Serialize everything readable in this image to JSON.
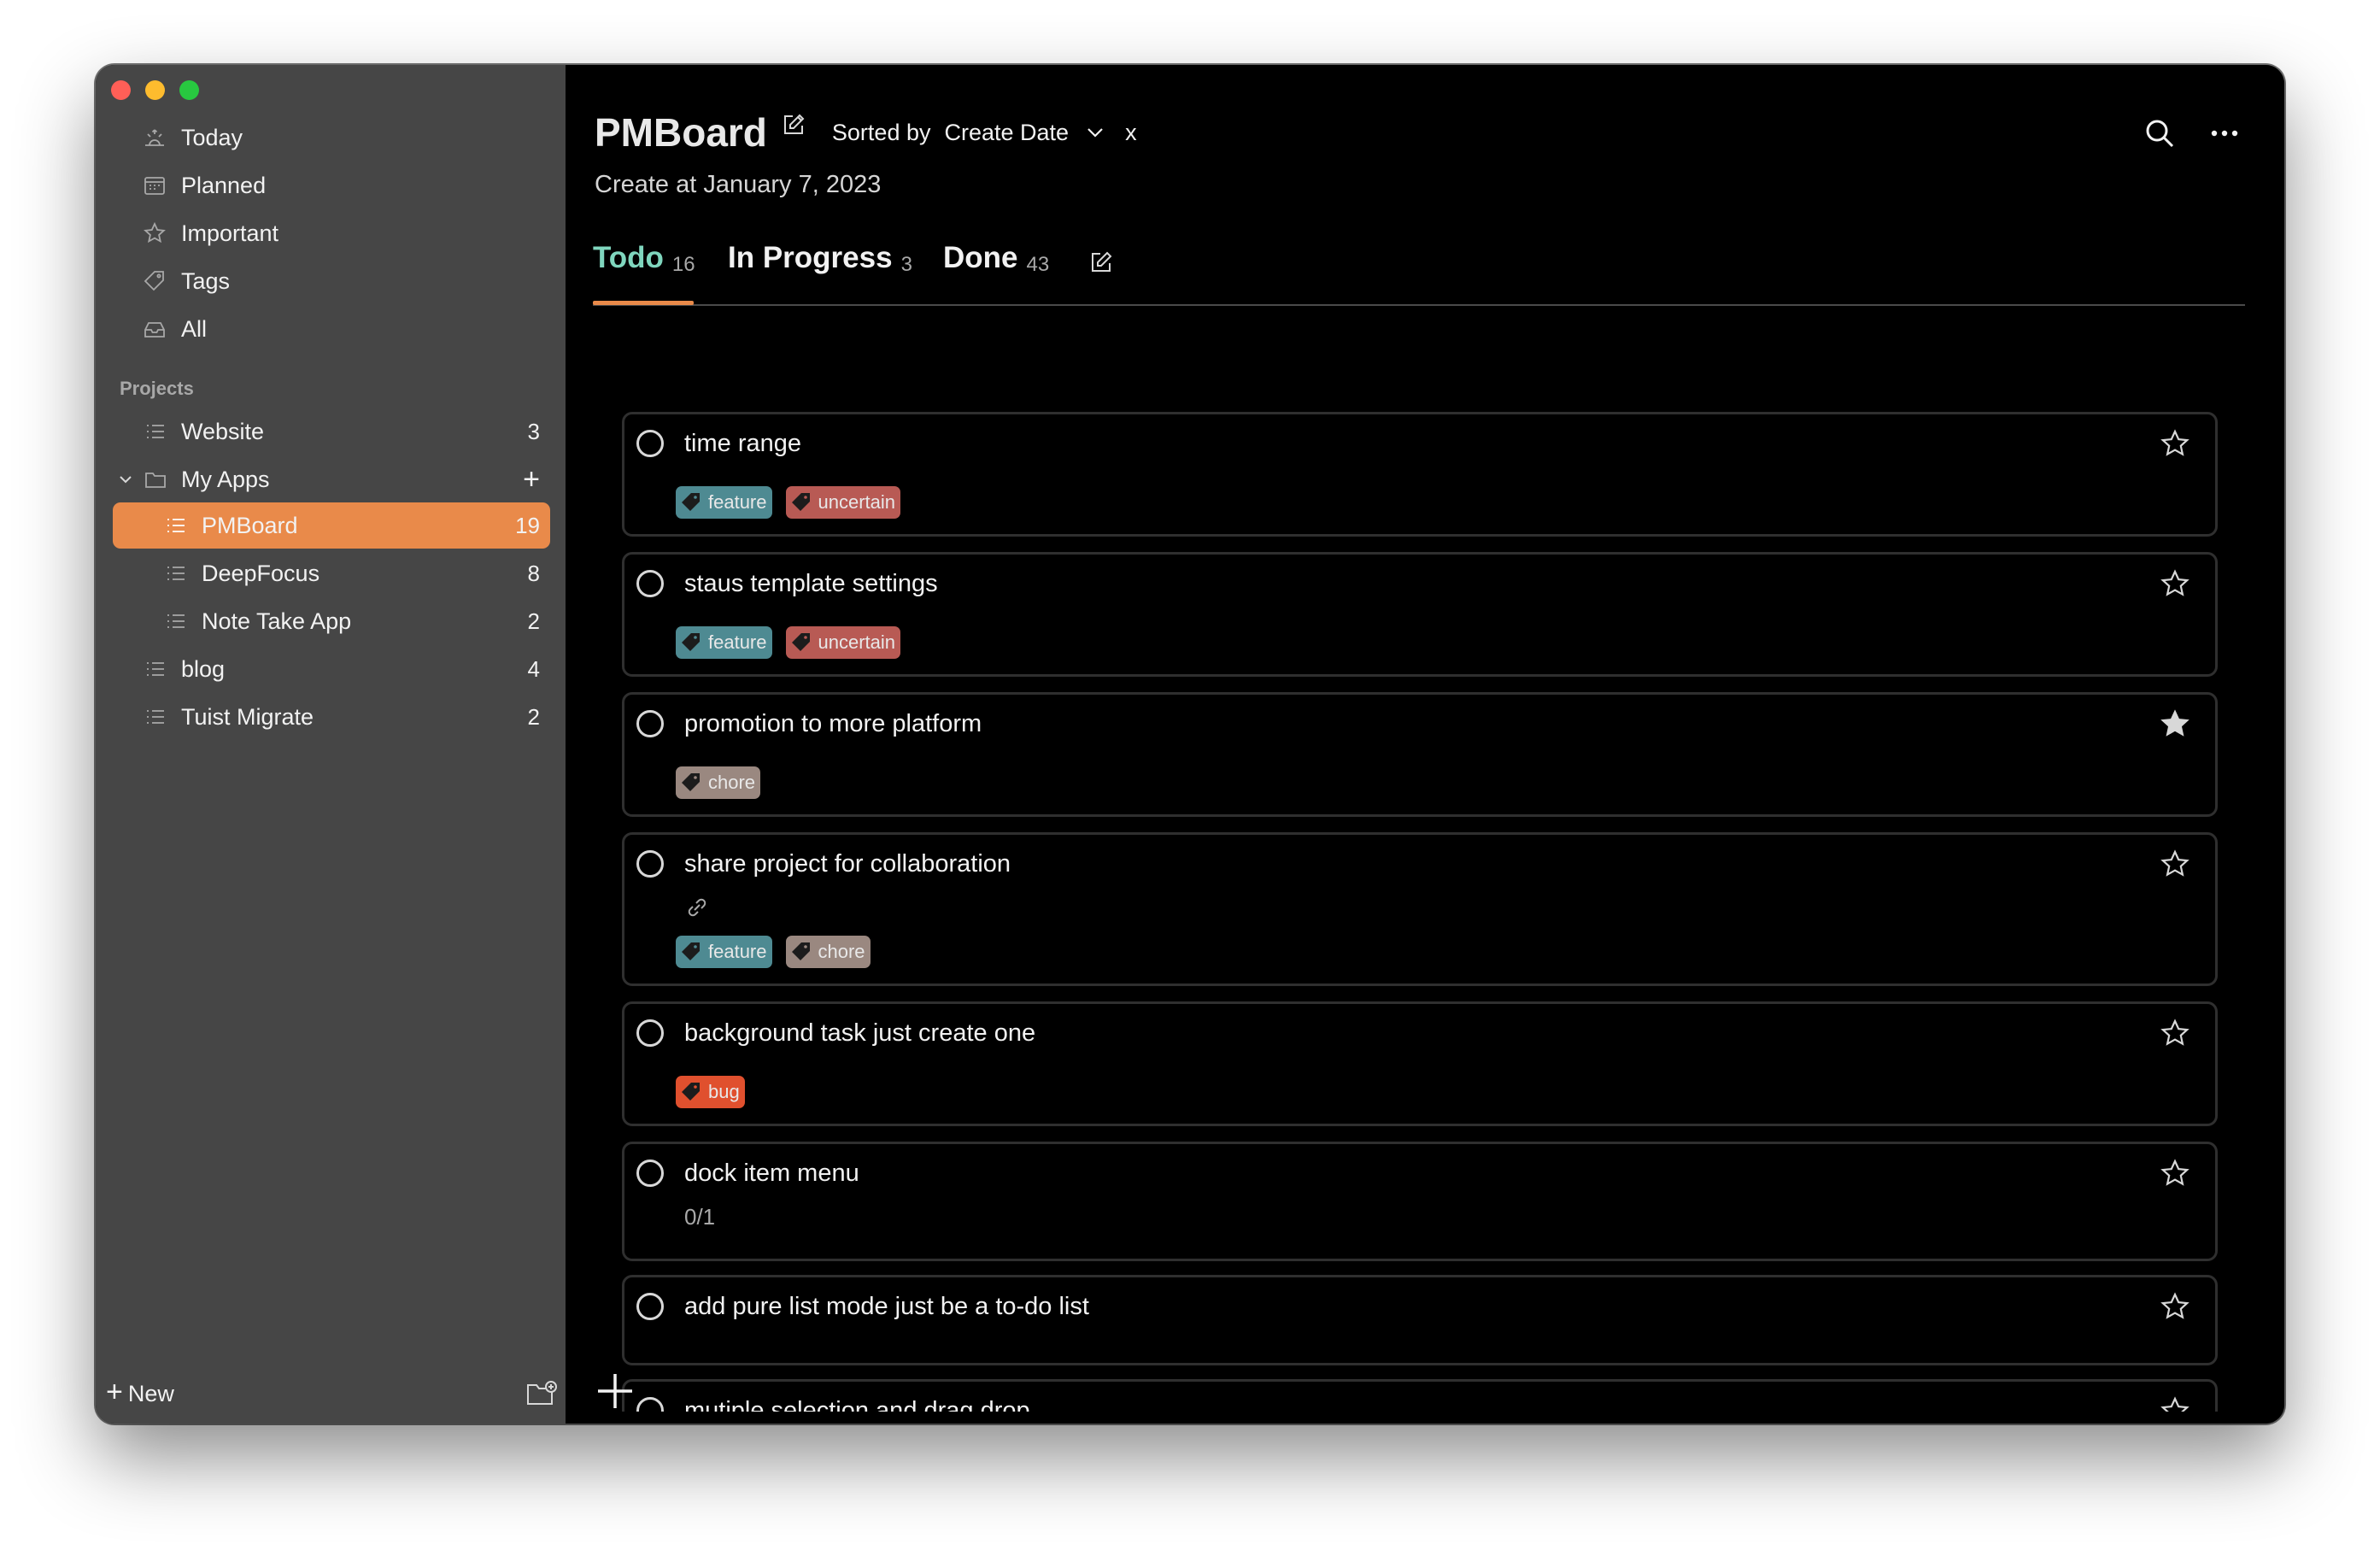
{
  "sidebar": {
    "nav": [
      {
        "label": "Today",
        "icon": "sunrise-icon"
      },
      {
        "label": "Planned",
        "icon": "calendar-icon"
      },
      {
        "label": "Important",
        "icon": "star-icon"
      },
      {
        "label": "Tags",
        "icon": "tag-icon"
      },
      {
        "label": "All",
        "icon": "tray-icon"
      }
    ],
    "section_label": "Projects",
    "projects": [
      {
        "label": "Website",
        "count": "3"
      },
      {
        "label": "My Apps"
      },
      {
        "label": "PMBoard",
        "count": "19"
      },
      {
        "label": "DeepFocus",
        "count": "8"
      },
      {
        "label": "Note Take App",
        "count": "2"
      },
      {
        "label": "blog",
        "count": "4"
      },
      {
        "label": "Tuist Migrate",
        "count": "2"
      }
    ],
    "new_label": "New"
  },
  "main": {
    "title": "PMBoard",
    "sorted_by_label": "Sorted by",
    "sort_value": "Create Date",
    "clear_label": "x",
    "created": "Create at January 7, 2023",
    "tabs": [
      {
        "label": "Todo",
        "count": "16"
      },
      {
        "label": "In Progress",
        "count": "3"
      },
      {
        "label": "Done",
        "count": "43"
      }
    ],
    "tasks": [
      {
        "title": "time range",
        "starred": false,
        "tags": [
          "feature",
          "uncertain"
        ]
      },
      {
        "title": "staus template settings",
        "starred": false,
        "tags": [
          "feature",
          "uncertain"
        ]
      },
      {
        "title": "promotion to more platform",
        "starred": true,
        "tags": [
          "chore"
        ]
      },
      {
        "title": "share project for collaboration",
        "starred": false,
        "tags": [
          "feature",
          "chore"
        ]
      },
      {
        "title": "background task just create one",
        "starred": false,
        "tags": [
          "bug"
        ]
      },
      {
        "title": "dock item menu",
        "starred": false,
        "subtasks": "0/1"
      },
      {
        "title": "add pure list mode just be a to-do list",
        "starred": false
      },
      {
        "title": "mutiple selection and drag drop",
        "starred": false
      }
    ]
  },
  "colors": {
    "sidebar_bg": "#464646",
    "accent": "#e98a4a",
    "active_tab": "#7fd6be",
    "tag_feature": "#4e8a92",
    "tag_uncertain": "#b85a54",
    "tag_chore": "#9a8880",
    "tag_bug": "#e0502e"
  }
}
